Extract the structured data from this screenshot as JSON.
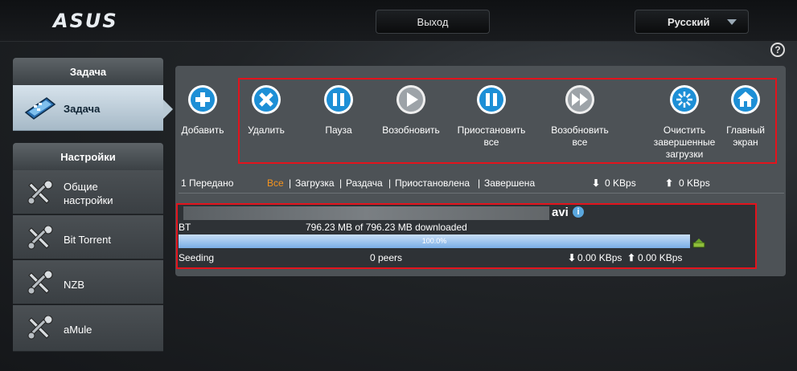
{
  "header": {
    "logo": "ASUS",
    "logout_label": "Выход",
    "language": "Русский"
  },
  "help_icon": "?",
  "sidebar": {
    "task_heading": "Задача",
    "task_item": "Задача",
    "settings_heading": "Настройки",
    "settings_items": [
      {
        "label_line1": "Общие",
        "label_line2": "настройки"
      },
      {
        "label_line1": "Bit Torrent",
        "label_line2": ""
      },
      {
        "label_line1": "NZB",
        "label_line2": ""
      },
      {
        "label_line1": "aMule",
        "label_line2": ""
      }
    ]
  },
  "toolbar": {
    "add": "Добавить",
    "delete": "Удалить",
    "pause": "Пауза",
    "resume": "Возобновить",
    "pause_all_1": "Приостановить",
    "pause_all_2": "все",
    "resume_all_1": "Возобновить",
    "resume_all_2": "все",
    "clear_1": "Очистить",
    "clear_2": "завершенные",
    "clear_3": "загрузки",
    "home_1": "Главный",
    "home_2": "экран"
  },
  "filters": {
    "count": "1 Передано",
    "all": "Все",
    "downloading": "Загрузка",
    "seeding": "Раздача",
    "paused": "Приостановлена",
    "finished": "Завершена",
    "sep": "|",
    "down_speed": "0 KBps",
    "up_speed": "0 KBps"
  },
  "download": {
    "ext": "avi",
    "type": "BT",
    "progress_text": "796.23 MB of 796.23 MB downloaded",
    "percent_label": "100.0%",
    "percent": 100,
    "status": "Seeding",
    "peers": "0 peers",
    "down_speed": "0.00 KBps",
    "up_speed": "0.00 KBps"
  },
  "colors": {
    "accent_active_filter": "#f7941d",
    "highlight_box": "#e3131c",
    "icon_blue": "#1d8fd6"
  }
}
